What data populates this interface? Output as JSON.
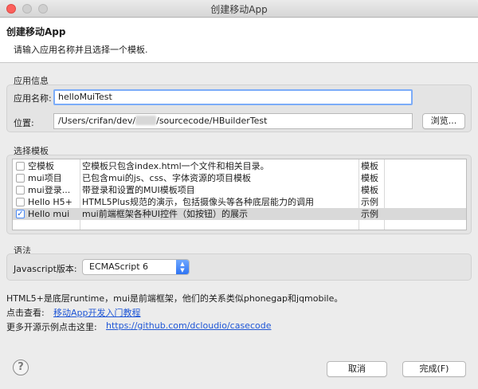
{
  "window": {
    "title": "创建移动App"
  },
  "header": {
    "title": "创建移动App",
    "description": "请输入应用名称并且选择一个模板."
  },
  "app_info": {
    "group_label": "应用信息",
    "name_label": "应用名称:",
    "name_value": "helloMuiTest",
    "location_label": "位置:",
    "location_prefix": "/Users/crifan/dev/",
    "location_suffix": "/sourcecode/HBuilderTest",
    "browse_button": "浏览..."
  },
  "templates": {
    "group_label": "选择模板",
    "rows": [
      {
        "name": "空模板",
        "description": "空模板只包含index.html一个文件和相关目录。",
        "type": "模板",
        "checked": false,
        "selected": false
      },
      {
        "name": "mui项目",
        "description": "已包含mui的js、css、字体资源的项目模板",
        "type": "模板",
        "checked": false,
        "selected": false
      },
      {
        "name": "mui登录...",
        "description": "带登录和设置的MUI模板项目",
        "type": "模板",
        "checked": false,
        "selected": false
      },
      {
        "name": "Hello H5+",
        "description": "HTML5Plus规范的演示，包括摄像头等各种底层能力的调用",
        "type": "示例",
        "checked": false,
        "selected": false
      },
      {
        "name": "Hello mui",
        "description": "mui前端框架各种UI控件（如按钮）的展示",
        "type": "示例",
        "checked": true,
        "selected": true
      }
    ]
  },
  "syntax": {
    "group_label": "语法",
    "js_version_label": "Javascript版本:",
    "js_version_value": "ECMAScript 6"
  },
  "info": {
    "line1": "HTML5+是底层runtime，mui是前端框架，他们的关系类似phonegap和jqmobile。",
    "line2_label": "点击查看:",
    "line2_link": "移动App开发入门教程",
    "line3_label": "更多开源示例点击这里:",
    "line3_link": "https://github.com/dcloudio/casecode"
  },
  "footer": {
    "cancel_button": "取消",
    "finish_button": "完成(F)",
    "help_icon": "?"
  }
}
